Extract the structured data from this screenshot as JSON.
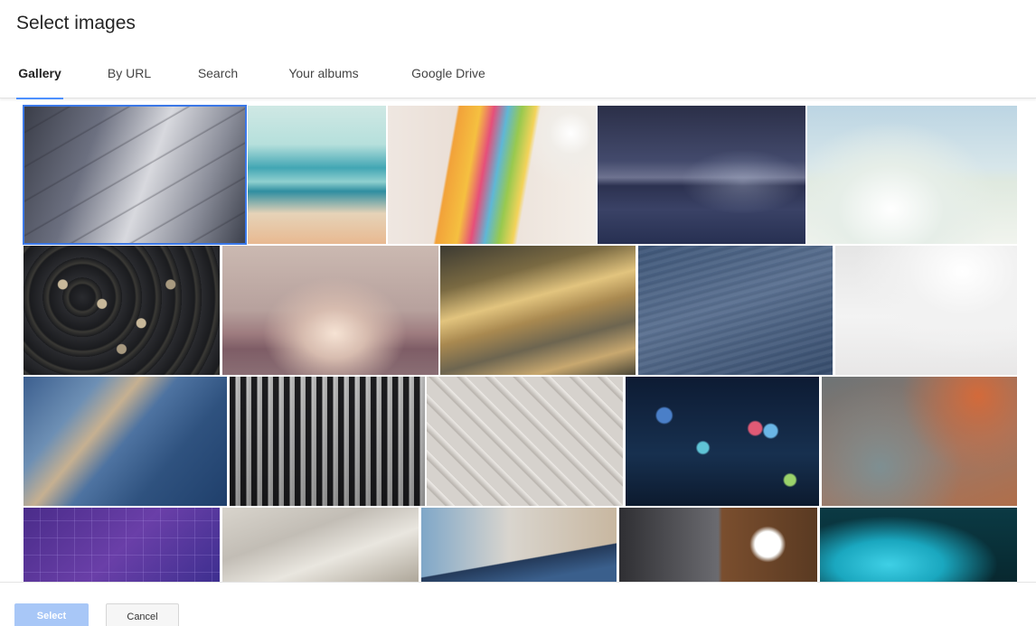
{
  "dialog": {
    "title": "Select images"
  },
  "tabs": [
    {
      "label": "Gallery",
      "active": true
    },
    {
      "label": "By URL",
      "active": false
    },
    {
      "label": "Search",
      "active": false
    },
    {
      "label": "Your albums",
      "active": false
    },
    {
      "label": "Google Drive",
      "active": false
    }
  ],
  "gallery": {
    "images": [
      {
        "name": "gallery-image-diagonal-wood-planks",
        "selected": true
      },
      {
        "name": "gallery-image-blurred-ocean",
        "selected": false
      },
      {
        "name": "gallery-image-sticky-notes",
        "selected": false
      },
      {
        "name": "gallery-image-night-lake",
        "selected": false
      },
      {
        "name": "gallery-image-frozen-shore",
        "selected": false
      },
      {
        "name": "gallery-image-typewriter-keys",
        "selected": false
      },
      {
        "name": "gallery-image-pink-horizon",
        "selected": false
      },
      {
        "name": "gallery-image-gold-blur",
        "selected": false
      },
      {
        "name": "gallery-image-blue-water-texture",
        "selected": false
      },
      {
        "name": "gallery-image-white-snow",
        "selected": false
      },
      {
        "name": "gallery-image-blue-dunes",
        "selected": false
      },
      {
        "name": "gallery-image-mixing-console",
        "selected": false
      },
      {
        "name": "gallery-image-geometric-pattern",
        "selected": false
      },
      {
        "name": "gallery-image-bokeh-lights",
        "selected": false
      },
      {
        "name": "gallery-image-orange-blur",
        "selected": false
      },
      {
        "name": "gallery-image-stock-chart",
        "selected": false
      },
      {
        "name": "gallery-image-desk-coffee",
        "selected": false
      },
      {
        "name": "gallery-image-tablet-desk",
        "selected": false
      },
      {
        "name": "gallery-image-laptop-coffee",
        "selected": false
      },
      {
        "name": "gallery-image-teal-light",
        "selected": false
      }
    ]
  },
  "footer": {
    "select_label": "Select",
    "cancel_label": "Cancel"
  }
}
